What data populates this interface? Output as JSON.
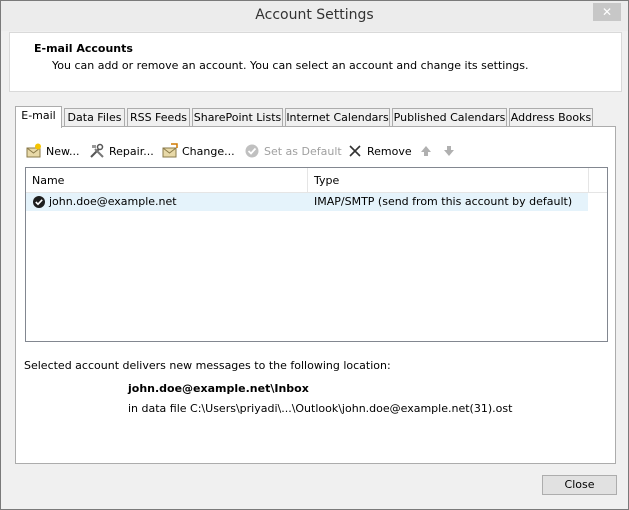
{
  "window": {
    "title": "Account Settings",
    "close_glyph": "✕"
  },
  "header": {
    "title": "E-mail Accounts",
    "description": "You can add or remove an account. You can select an account and change its settings."
  },
  "tabs": [
    {
      "label": "E-mail",
      "active": true
    },
    {
      "label": "Data Files",
      "active": false
    },
    {
      "label": "RSS Feeds",
      "active": false
    },
    {
      "label": "SharePoint Lists",
      "active": false
    },
    {
      "label": "Internet Calendars",
      "active": false
    },
    {
      "label": "Published Calendars",
      "active": false
    },
    {
      "label": "Address Books",
      "active": false
    }
  ],
  "toolbar": {
    "new_label": "New...",
    "repair_label": "Repair...",
    "change_label": "Change...",
    "set_default_label": "Set as Default",
    "remove_label": "Remove"
  },
  "accounts_list": {
    "columns": [
      "Name",
      "Type"
    ],
    "rows": [
      {
        "name": "john.doe@example.net",
        "type": "IMAP/SMTP (send from this account by default)"
      }
    ]
  },
  "delivery": {
    "label": "Selected account delivers new messages to the following location:",
    "inbox_path": "john.doe@example.net\\Inbox",
    "data_file": "in data file C:\\Users\\priyadi\\...\\Outlook\\john.doe@example.net(31).ost"
  },
  "footer": {
    "close_label": "Close"
  }
}
